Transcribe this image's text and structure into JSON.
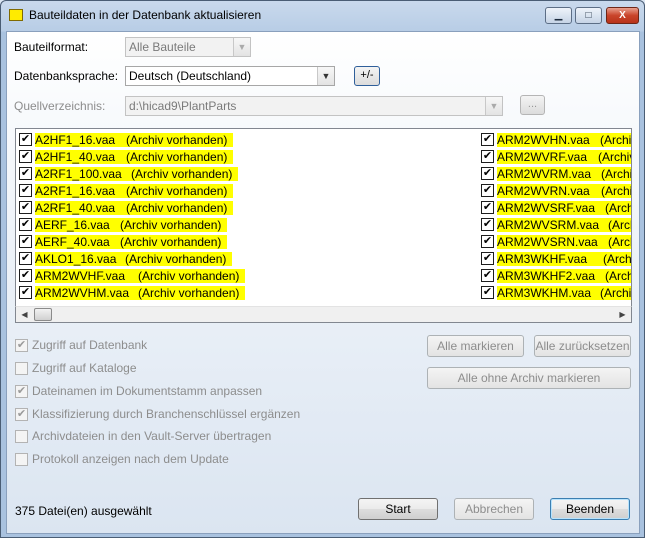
{
  "window": {
    "title": "Bauteildaten in der Datenbank aktualisieren"
  },
  "caption_buttons": {
    "minimize": "▁",
    "maximize": "□",
    "close": "X"
  },
  "form": {
    "bauteilformat_label": "Bauteilformat:",
    "bauteilformat_value": "Alle Bauteile",
    "sprache_label": "Datenbanksprache:",
    "sprache_value": "Deutsch (Deutschland)",
    "plusminus_label": "+/-",
    "quelle_label": "Quellverzeichnis:",
    "quelle_value": "d:\\hicad9\\PlantParts",
    "browse_label": "..."
  },
  "file_list": {
    "archive_text": "(Archiv vorhanden)",
    "left_items": [
      "A2HF1_16.vaa",
      "A2HF1_40.vaa",
      "A2RF1_100.vaa",
      "A2RF1_16.vaa",
      "A2RF1_40.vaa",
      "AERF_16.vaa",
      "AERF_40.vaa",
      "AKLO1_16.vaa",
      "ARM2WVHF.vaa",
      "ARM2WVHM.vaa"
    ],
    "right_items": [
      {
        "name": "ARM2WVHN.vaa",
        "arch": "(Archiv"
      },
      {
        "name": "ARM2WVRF.vaa",
        "arch": "(Archiv"
      },
      {
        "name": "ARM2WVRM.vaa",
        "arch": "(Archiv"
      },
      {
        "name": "ARM2WVRN.vaa",
        "arch": "(Archiv"
      },
      {
        "name": "ARM2WVSRF.vaa",
        "arch": "(Archi"
      },
      {
        "name": "ARM2WVSRM.vaa",
        "arch": "(Arch"
      },
      {
        "name": "ARM2WVSRN.vaa",
        "arch": "(Arch"
      },
      {
        "name": "ARM3WKHF.vaa",
        "arch": "(Archiv"
      },
      {
        "name": "ARM3WKHF2.vaa",
        "arch": "(Archi"
      },
      {
        "name": "ARM3WKHM.vaa",
        "arch": "(Archiv"
      }
    ],
    "highlight_color": "#ffff00"
  },
  "options": [
    {
      "label": "Zugriff auf Datenbank",
      "checked": true
    },
    {
      "label": "Zugriff auf Kataloge",
      "checked": false
    },
    {
      "label": "Dateinamen im Dokumentstamm anpassen",
      "checked": true
    },
    {
      "label": "Klassifizierung durch Branchenschlüssel ergänzen",
      "checked": true
    },
    {
      "label": "Archivdateien in den Vault-Server übertragen",
      "checked": false
    },
    {
      "label": "Protokoll anzeigen nach dem Update",
      "checked": false
    }
  ],
  "buttons": {
    "alle_markieren": "Alle markieren",
    "alle_zuruecksetzen": "Alle zurücksetzen",
    "alle_ohne_archiv": "Alle ohne Archiv markieren",
    "start": "Start",
    "abbrechen": "Abbrechen",
    "beenden": "Beenden"
  },
  "status": {
    "selected_text": "375 Datei(en) ausgewählt"
  }
}
